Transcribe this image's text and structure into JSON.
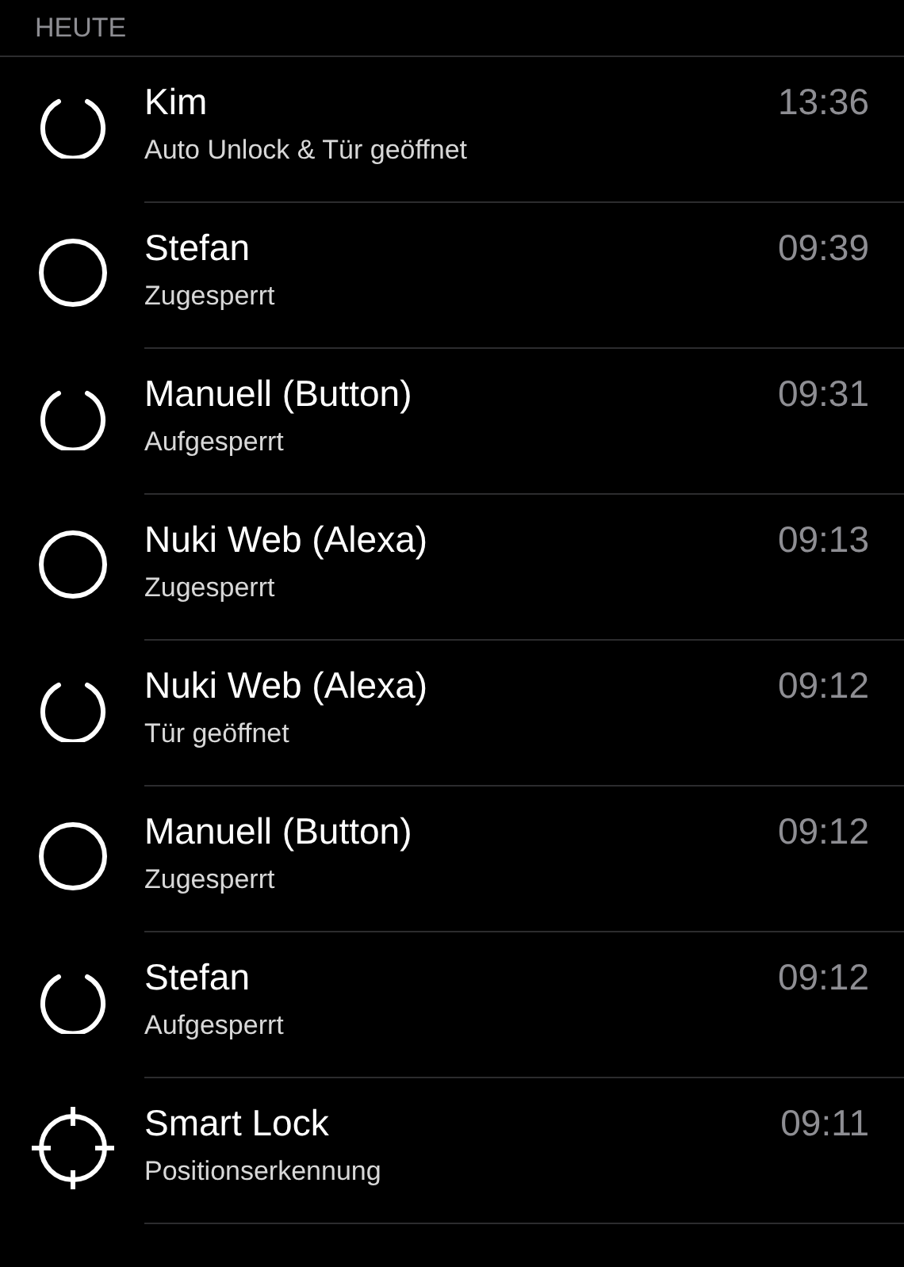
{
  "section": {
    "title": "HEUTE"
  },
  "events": [
    {
      "kind": "unlocked",
      "name": "Kim",
      "action": "Auto Unlock & Tür geöffnet",
      "time": "13:36"
    },
    {
      "kind": "locked",
      "name": "Stefan",
      "action": "Zugesperrt",
      "time": "09:39"
    },
    {
      "kind": "unlocked",
      "name": "Manuell (Button)",
      "action": "Aufgesperrt",
      "time": "09:31"
    },
    {
      "kind": "locked",
      "name": "Nuki Web (Alexa)",
      "action": "Zugesperrt",
      "time": "09:13"
    },
    {
      "kind": "unlocked",
      "name": "Nuki Web (Alexa)",
      "action": "Tür geöffnet",
      "time": "09:12"
    },
    {
      "kind": "locked",
      "name": "Manuell (Button)",
      "action": "Zugesperrt",
      "time": "09:12"
    },
    {
      "kind": "unlocked",
      "name": "Stefan",
      "action": "Aufgesperrt",
      "time": "09:12"
    },
    {
      "kind": "position",
      "name": "Smart Lock",
      "action": "Positionserkennung",
      "time": "09:11"
    }
  ]
}
